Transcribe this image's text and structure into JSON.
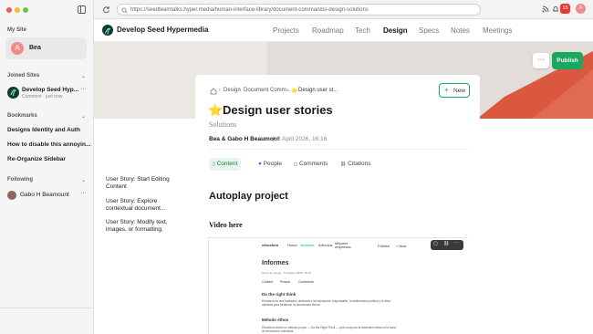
{
  "browser": {
    "url": "https://seedteamtalks.hyper.media/human-interface-library/document-commands/-design-solutions",
    "notification_count": "15"
  },
  "sidebar": {
    "my_site_heading": "My Site",
    "my_site": {
      "name": "Bea",
      "avatar_letter": "A"
    },
    "joined_sites_heading": "Joined Sites",
    "joined_site": {
      "name": "Develop Seed Hyp...",
      "subtitle": "Comment · just now"
    },
    "bookmarks_heading": "Bookmarks",
    "bookmarks": [
      "Designs Identity and Auth",
      "How to disable this annoyin...",
      "Re-Organize Sidebar"
    ],
    "following_heading": "Following",
    "following": [
      {
        "name": "Gabo H Beamount"
      }
    ]
  },
  "site_nav": {
    "site_name": "Develop Seed Hypermedia",
    "links": [
      "Projects",
      "Roadmap",
      "Tech",
      "Design",
      "Specs",
      "Notes",
      "Meetings"
    ],
    "active": "Design",
    "more_label": "···",
    "publish_label": "Publish"
  },
  "document": {
    "breadcrumbs": [
      "Design",
      "Document Comm...",
      "Design user st..."
    ],
    "new_label": "New",
    "emoji": "⭐",
    "title": "Design user stories",
    "subtitle": "Solutions",
    "authors": "Bea & Gabo H Beaumont",
    "date": "8 April 2026, 16:16",
    "tabs": [
      "Content",
      "People",
      "Comments",
      "Citations"
    ],
    "active_tab": "Content",
    "heading": "Autoplay project",
    "video_label": "Video here"
  },
  "outline": [
    "User Story: Start Editing Content",
    "User Story: Explore contextual document...",
    "User Story: Modify text, images, or formatting."
  ],
  "preview": {
    "site": "ethosfera",
    "nav": [
      "Home",
      "Informes",
      "Artículos",
      "Mejores empresas"
    ],
    "title": "Informes",
    "meta": "Rocío de Lange · 8 October 2025, 15:15",
    "tabs": [
      "Content",
      "People",
      "Comments"
    ],
    "h1": "Do the right think",
    "p1": "Ethosfera es una fundación dedicada a la información responsable, la deliberación pública y la ética aplicada para fortalecer la democracia liberal.",
    "h2": "Método éthos",
    "p2": "Ethosfera ofrece un método propio — Do the Right Think — que incorpora la dimensión ética en la toma de decisiones colectivas.",
    "publish": "Publish",
    "new": "+ New"
  }
}
